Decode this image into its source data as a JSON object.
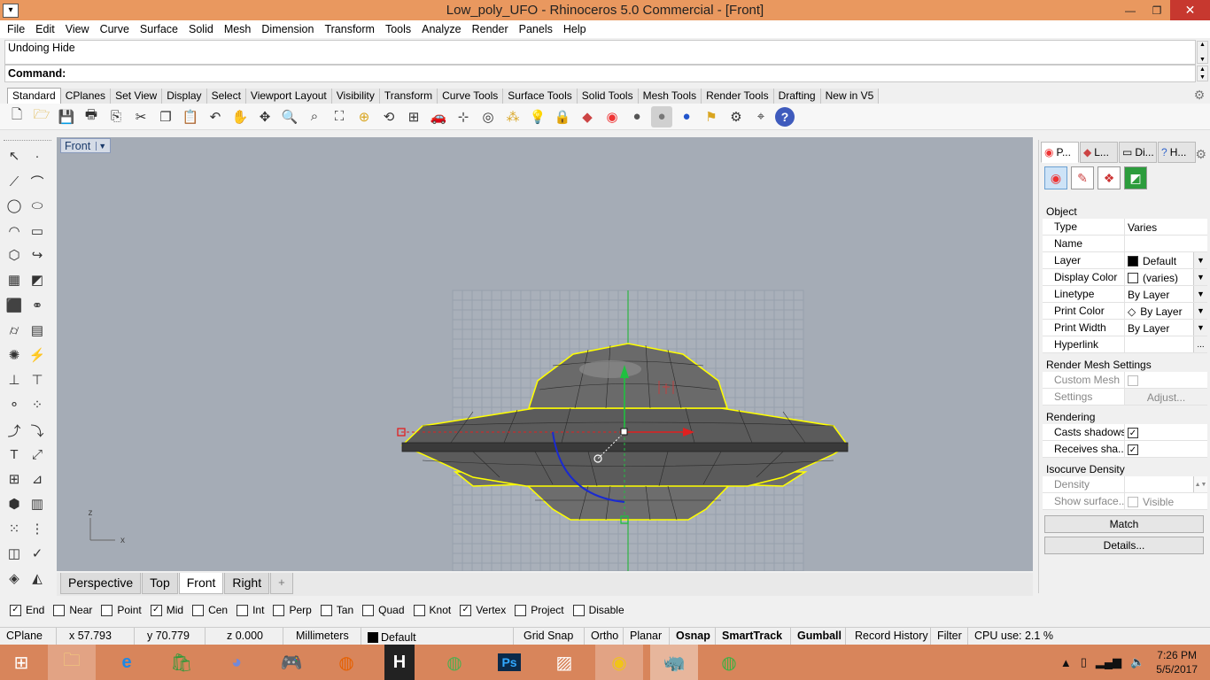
{
  "window": {
    "title": "Low_poly_UFO - Rhinoceros 5.0 Commercial - [Front]",
    "minimize": "—",
    "maximize": "❐",
    "close": "✕"
  },
  "menu": [
    "File",
    "Edit",
    "View",
    "Curve",
    "Surface",
    "Solid",
    "Mesh",
    "Dimension",
    "Transform",
    "Tools",
    "Analyze",
    "Render",
    "Panels",
    "Help"
  ],
  "command": {
    "history": "Undoing Hide",
    "prompt": "Command:"
  },
  "toolbar_tabs": [
    "Standard",
    "CPlanes",
    "Set View",
    "Display",
    "Select",
    "Viewport Layout",
    "Visibility",
    "Transform",
    "Curve Tools",
    "Surface Tools",
    "Solid Tools",
    "Mesh Tools",
    "Render Tools",
    "Drafting",
    "New in V5"
  ],
  "toolbar_icons": [
    "new-icon",
    "open-icon",
    "save-icon",
    "print-icon",
    "import-icon",
    "cut-icon",
    "copy-icon",
    "paste-icon",
    "undo-icon",
    "pan-icon",
    "rotate-view-icon",
    "zoom-dynamic-icon",
    "zoom-window-icon",
    "zoom-extents-icon",
    "zoom-selected-icon",
    "undo-view-icon",
    "four-viewports-icon",
    "car-icon",
    "osnap-icon",
    "cplane-icon",
    "points-icon",
    "light-bulb-icon",
    "lock-icon",
    "layer-icon",
    "color-wheel-icon",
    "render-sphere-icon",
    "material-sphere-icon",
    "blue-sphere-icon",
    "select-filter-icon",
    "options-gear-icon",
    "gumball-icon",
    "help-icon"
  ],
  "viewport": {
    "name": "Front",
    "axis_z": "z",
    "axis_x": "x",
    "tabs": [
      "Perspective",
      "Top",
      "Front",
      "Right"
    ],
    "add_tab": "+"
  },
  "right_panel": {
    "tabs": [
      {
        "short": "P...",
        "icon": "properties-icon"
      },
      {
        "short": "L...",
        "icon": "layers-icon"
      },
      {
        "short": "Di...",
        "icon": "display-icon"
      },
      {
        "short": "H...",
        "icon": "help-panel-icon"
      }
    ],
    "section_object": "Object",
    "rows": [
      {
        "key": "Type",
        "value": "Varies"
      },
      {
        "key": "Name",
        "value": ""
      },
      {
        "key": "Layer",
        "value": "Default"
      },
      {
        "key": "Display Color",
        "value": "(varies)"
      },
      {
        "key": "Linetype",
        "value": "By Layer"
      },
      {
        "key": "Print Color",
        "value": "By Layer"
      },
      {
        "key": "Print Width",
        "value": "By Layer"
      },
      {
        "key": "Hyperlink",
        "value": "",
        "button": "..."
      }
    ],
    "section_mesh": "Render Mesh Settings",
    "custom_mesh": "Custom Mesh",
    "settings": "Settings",
    "adjust": "Adjust...",
    "section_rendering": "Rendering",
    "casts_shadows": "Casts shadows",
    "receives_shadows": "Receives sha...",
    "section_isocurve": "Isocurve Density",
    "density": "Density",
    "show_surface": "Show surface...",
    "visible": "Visible",
    "match": "Match",
    "details": "Details..."
  },
  "osnaps": [
    {
      "label": "End",
      "checked": true
    },
    {
      "label": "Near",
      "checked": false
    },
    {
      "label": "Point",
      "checked": false
    },
    {
      "label": "Mid",
      "checked": true
    },
    {
      "label": "Cen",
      "checked": false
    },
    {
      "label": "Int",
      "checked": false
    },
    {
      "label": "Perp",
      "checked": false
    },
    {
      "label": "Tan",
      "checked": false
    },
    {
      "label": "Quad",
      "checked": false
    },
    {
      "label": "Knot",
      "checked": false
    },
    {
      "label": "Vertex",
      "checked": true
    },
    {
      "label": "Project",
      "checked": false
    },
    {
      "label": "Disable",
      "checked": false
    }
  ],
  "status": {
    "cplane": "CPlane",
    "x": "x 57.793",
    "y": "y 70.779",
    "z": "z 0.000",
    "units": "Millimeters",
    "layer": "Default",
    "grid_snap": "Grid Snap",
    "ortho": "Ortho",
    "planar": "Planar",
    "osnap": "Osnap",
    "smarttrack": "SmartTrack",
    "gumball": "Gumball",
    "record_history": "Record History",
    "filter": "Filter",
    "cpu": "CPU use: 2.1 %"
  },
  "taskbar": {
    "apps": [
      "windows-start-icon",
      "file-explorer-icon",
      "internet-explorer-icon",
      "store-icon",
      "discord-icon",
      "game-icon",
      "firefox-icon",
      "h-app-icon",
      "globe-app-icon",
      "photoshop-icon",
      "chart-app-icon",
      "chrome-icon",
      "rhino-icon",
      "network-globe-icon"
    ],
    "ps_label": "Ps",
    "time": "7:26 PM",
    "date": "5/5/2017"
  },
  "colors": {
    "title_bar": "#e9985f",
    "taskbar": "#d8855b",
    "viewport_bg": "#a5acb6",
    "selection_yellow": "#ffff00",
    "gumball_red": "#e02020",
    "gumball_green": "#20c040",
    "gumball_blue": "#1a2ad0"
  }
}
